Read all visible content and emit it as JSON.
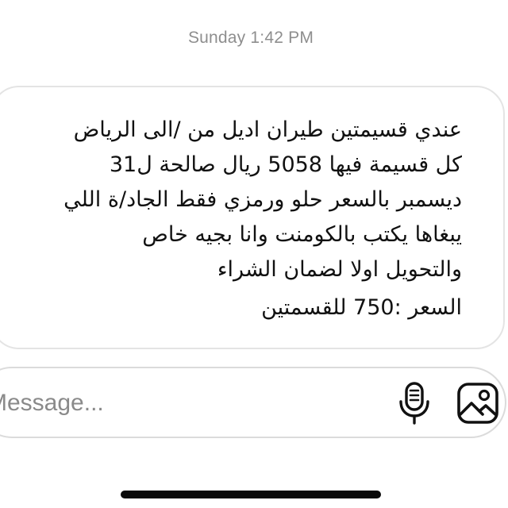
{
  "thread": {
    "timestamp": "Sunday 1:42 PM"
  },
  "message": {
    "lines": [
      "عندي قسيمتين طيران اديل من /الى الرياض",
      "كل قسيمة فيها 5058 ريال صالحة ل31",
      "ديسمبر بالسعر حلو ورمزي فقط الجاد/ة اللي",
      "يبغاها يكتب بالكومنت وانا بجيه خاص",
      "والتحويل اولا  لضمان الشراء",
      "السعر :750 للقسمتين"
    ]
  },
  "composer": {
    "placeholder": "Message...",
    "value": "",
    "mic_icon": "microphone-icon",
    "photo_icon": "photo-gallery-icon"
  }
}
